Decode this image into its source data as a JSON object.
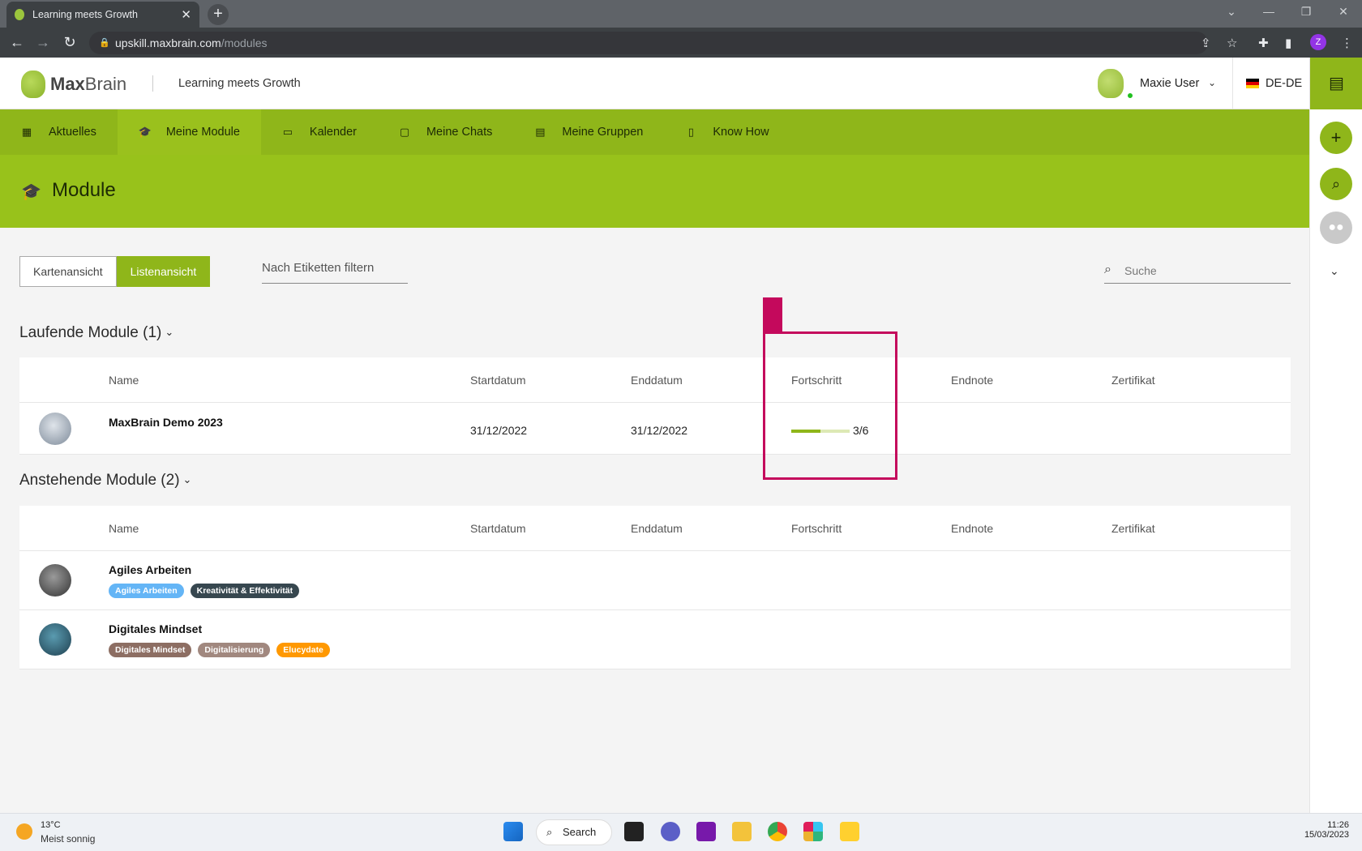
{
  "browser": {
    "tab_title": "Learning meets Growth",
    "tab_close": "✕",
    "new_tab": "+",
    "url_host": "upskill.maxbrain.com",
    "url_path": "/modules",
    "profile_initial": "Z"
  },
  "header": {
    "logo_max": "Max",
    "logo_brain": "Brain",
    "tagline": "Learning meets Growth",
    "user_name": "Maxie User",
    "language": "DE-DE"
  },
  "nav": {
    "items": [
      {
        "label": "Aktuelles",
        "icon": "newspaper-icon"
      },
      {
        "label": "Meine Module",
        "icon": "graduation-cap-icon"
      },
      {
        "label": "Kalender",
        "icon": "calendar-icon"
      },
      {
        "label": "Meine Chats",
        "icon": "inbox-icon"
      },
      {
        "label": "Meine Gruppen",
        "icon": "group-folder-icon"
      },
      {
        "label": "Know How",
        "icon": "book-icon"
      }
    ],
    "active_index": 1
  },
  "page": {
    "title": "Module"
  },
  "toolbar": {
    "card_view": "Kartenansicht",
    "list_view": "Listenansicht",
    "tag_filter_placeholder": "Nach Etiketten filtern",
    "search_placeholder": "Suche"
  },
  "running": {
    "title": "Laufende Module (1)",
    "columns": [
      "Name",
      "Startdatum",
      "Enddatum",
      "Fortschritt",
      "Endnote",
      "Zertifikat"
    ],
    "rows": [
      {
        "name": "MaxBrain Demo 2023",
        "start": "31/12/2022",
        "end": "31/12/2022",
        "progress_text": "3/6",
        "progress_fraction": 0.5
      }
    ]
  },
  "upcoming": {
    "title": "Anstehende Module (2)",
    "columns": [
      "Name",
      "Startdatum",
      "Enddatum",
      "Fortschritt",
      "Endnote",
      "Zertifikat"
    ],
    "rows": [
      {
        "name": "Agiles Arbeiten",
        "tags": [
          {
            "label": "Agiles Arbeiten",
            "color": "#64b5f6"
          },
          {
            "label": "Kreativität & Effektivität",
            "color": "#37474f"
          }
        ]
      },
      {
        "name": "Digitales Mindset",
        "tags": [
          {
            "label": "Digitales Mindset",
            "color": "#8d6e63"
          },
          {
            "label": "Digitalisierung",
            "color": "#a1887f"
          },
          {
            "label": "Elucydate",
            "color": "#ff9800"
          }
        ]
      }
    ]
  },
  "taskbar": {
    "temperature": "13°C",
    "weather": "Meist sonnig",
    "search_label": "Search",
    "time": "11:26",
    "date": "15/03/2023"
  },
  "colors": {
    "brand_green": "#8fb61a",
    "title_band": "#98c21b",
    "highlight": "#c4095c"
  }
}
